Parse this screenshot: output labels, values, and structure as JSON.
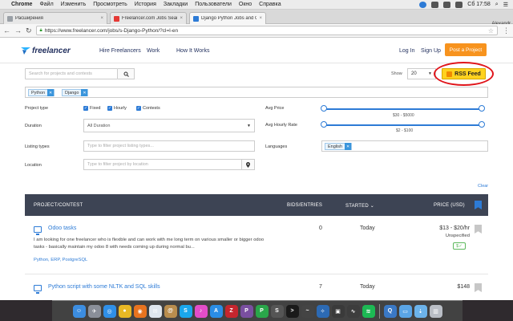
{
  "menubar": {
    "apple": "",
    "app": "Chrome",
    "items": [
      "Файл",
      "Изменить",
      "Просмотреть",
      "История",
      "Закладки",
      "Пользователи",
      "Окно",
      "Справка"
    ],
    "clock": "Сб 17:58"
  },
  "tabs": [
    {
      "label": "Расширения",
      "color": "#9aa0a6"
    },
    {
      "label": "Freelancer.com Jobs Sear",
      "color": "#e53935"
    },
    {
      "label": "Django Python Jobs and C",
      "color": "#2d7bd6"
    }
  ],
  "user": "Alexandr",
  "url": "https://www.freelancer.com/jobs/s-Django-Python/?cl=l-en",
  "header": {
    "logo": "freelancer",
    "nav": [
      "Hire Freelancers",
      "Work",
      "How It Works"
    ],
    "login": "Log In",
    "signup": "Sign Up",
    "post": "Post a Project"
  },
  "search": {
    "placeholder": "Search for projects and contests",
    "show_label": "Show",
    "show_value": "20",
    "rss": "RSS Feed",
    "highlight_color": "#e0151b"
  },
  "skills": [
    "Python",
    "Django"
  ],
  "filters": {
    "project_type_label": "Project type",
    "types": [
      "Fixed",
      "Hourly",
      "Contests"
    ],
    "avg_price_label": "Avg Price",
    "avg_price_range": "$30 - $5000",
    "avg_hourly_label": "Avg Hourly Rate",
    "avg_hourly_range": "$2 - $100",
    "duration_label": "Duration",
    "duration_value": "All Duration",
    "listing_label": "Listing types",
    "listing_placeholder": "Type to filter project listing types...",
    "languages_label": "Languages",
    "language_chip": "English",
    "location_label": "Location",
    "location_placeholder": "Type to filter project by location",
    "clear": "Clear"
  },
  "table": {
    "headers": {
      "project": "Project/Contest",
      "bids": "Bids/Entries",
      "started": "Started",
      "price": "Price (USD)"
    },
    "rows": [
      {
        "title": "Odoo tasks",
        "desc": "I am looking for one freelancer who is flexible and can work with me long term on various smaller or bigger odoo tasks - basically maintain my odoo 8 with needs coming up during normal bu...",
        "skills": "Python, ERP, PostgreSQL",
        "bids": "0",
        "started": "Today",
        "price": "$13 - $20/hr",
        "price_type": "Unspecified",
        "badge": "$✓"
      },
      {
        "title": "Python script with some NLTK and SQL skills",
        "desc": "",
        "skills": "",
        "bids": "7",
        "started": "Today",
        "price": "$148",
        "price_type": "",
        "badge": ""
      }
    ]
  },
  "dock": {
    "apps": [
      {
        "icon": "finder-icon",
        "color": "#3c8de0",
        "glyph": "☺"
      },
      {
        "icon": "launchpad-icon",
        "color": "#8a8f99",
        "glyph": "✈"
      },
      {
        "icon": "safari-icon",
        "color": "#2f8fe8",
        "glyph": "◎"
      },
      {
        "icon": "chrome-icon",
        "color": "#e9b824",
        "glyph": "●"
      },
      {
        "icon": "firefox-icon",
        "color": "#e8731f",
        "glyph": "◉"
      },
      {
        "icon": "mail-icon",
        "color": "#dfe6ee",
        "glyph": "✉"
      },
      {
        "icon": "contacts-icon",
        "color": "#b98d4e",
        "glyph": "@"
      },
      {
        "icon": "skype-icon",
        "color": "#1aa7ec",
        "glyph": "S"
      },
      {
        "icon": "itunes-icon",
        "color": "#e34dc9",
        "glyph": "♪"
      },
      {
        "icon": "app-store-icon",
        "color": "#2a8de6",
        "glyph": "A"
      },
      {
        "icon": "filezilla-icon",
        "color": "#c6262e",
        "glyph": "Z"
      },
      {
        "icon": "php-icon",
        "color": "#7a4fa0",
        "glyph": "P"
      },
      {
        "icon": "pycharm-icon",
        "color": "#2aa64a",
        "glyph": "P"
      },
      {
        "icon": "sublime-icon",
        "color": "#555",
        "glyph": "S"
      },
      {
        "icon": "terminal-icon",
        "color": "#1a1a1a",
        "glyph": ">"
      },
      {
        "icon": "activity-icon",
        "color": "#444",
        "glyph": "~"
      },
      {
        "icon": "xcode-icon",
        "color": "#2c6ab4",
        "glyph": "✧"
      },
      {
        "icon": "monitor-icon",
        "color": "#3a3a3a",
        "glyph": "▣"
      },
      {
        "icon": "instruments-icon",
        "color": "#3d3d3d",
        "glyph": "∿"
      },
      {
        "icon": "spotify-icon",
        "color": "#1db954",
        "glyph": "≋"
      },
      {
        "icon": "quicktime-icon",
        "color": "#3a78c5",
        "glyph": "Q"
      },
      {
        "icon": "folder-icon",
        "color": "#5aa5e6",
        "glyph": "▭"
      },
      {
        "icon": "downloads-icon",
        "color": "#6cb3ea",
        "glyph": "⇣"
      },
      {
        "icon": "trash-icon",
        "color": "#b9bec5",
        "glyph": "▥"
      }
    ]
  }
}
